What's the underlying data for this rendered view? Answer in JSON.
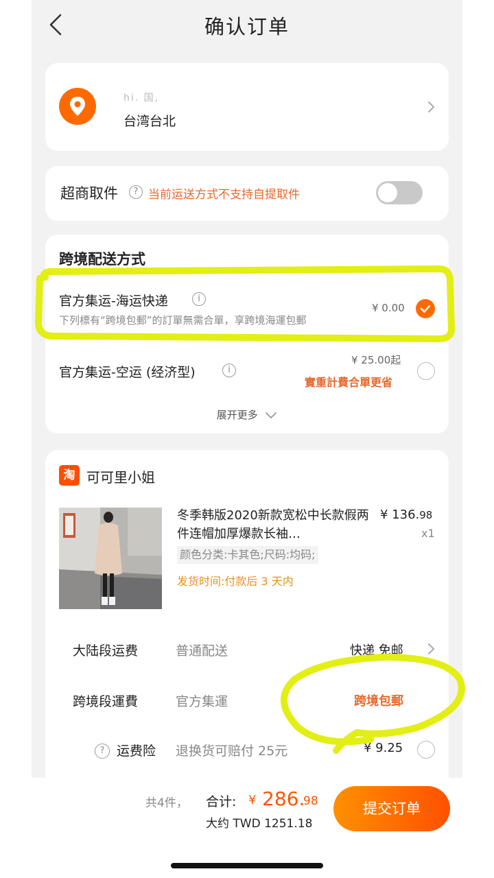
{
  "header": {
    "title": "确认订单"
  },
  "address": {
    "name_redacted": "hi. 国,",
    "line": "台湾台北"
  },
  "pickup": {
    "label": "超商取件",
    "note": "当前运送方式不支持自提取件"
  },
  "shipping": {
    "heading": "跨境配送方式",
    "options": [
      {
        "title": "官方集运-海运快递",
        "subtitle": "下列標有“跨境包郵”的訂單無需合單，享跨境海運包郵",
        "price": "¥ 0.00",
        "selected": true
      },
      {
        "title": "官方集运-空运 (经济型)",
        "price": "¥ 25.00起",
        "tag": "實重計費合單更省",
        "selected": false
      }
    ],
    "expand": "展开更多"
  },
  "shop": {
    "logo": "淘",
    "name": "可可里小姐",
    "product": {
      "title": "冬季韩版2020新款宽松中长款假两件连帽加厚爆款长袖…",
      "price_main": "¥ 136.",
      "price_cents": "98",
      "qty": "x1",
      "spec": "颜色分类:卡其色;尺码:均码;",
      "ship_time": "发货时间:付款后 3 天内"
    },
    "rows": [
      {
        "label": "大陆段运费",
        "sub": "普通配送",
        "value": "快递 免邮"
      },
      {
        "label": "跨境段運費",
        "sub": "官方集運",
        "value": "跨境包郵"
      },
      {
        "label": "运费险",
        "sub": "退换货可赔付 25元",
        "value": "¥ 9.25"
      }
    ]
  },
  "footer": {
    "count": "共4件，",
    "total_label": "合计:",
    "currency": "¥",
    "total_int": "286.",
    "total_dec": "98",
    "twd": "大约 TWD 1251.18",
    "submit": "提交订单"
  },
  "colors": {
    "accent": "#ff6a00",
    "highlight": "#e8f013"
  }
}
